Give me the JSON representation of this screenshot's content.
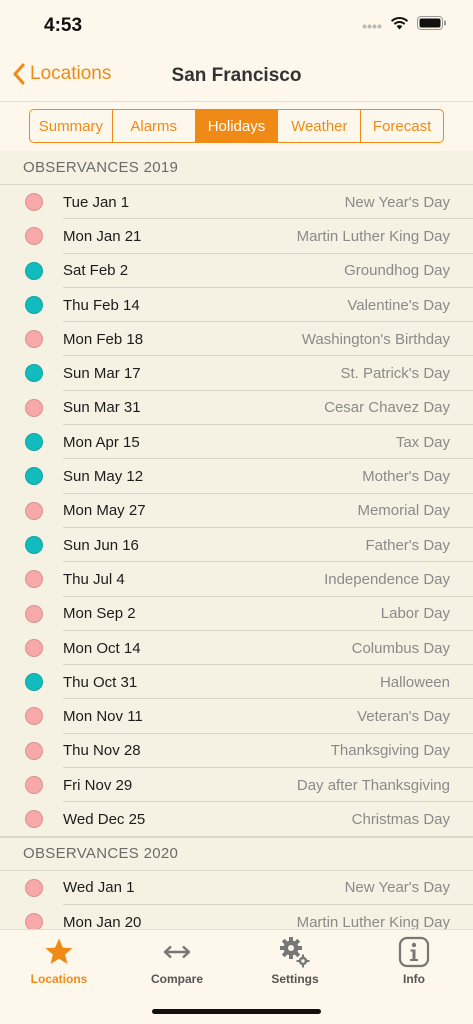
{
  "status": {
    "time": "4:53"
  },
  "nav": {
    "back_label": "Locations",
    "title": "San Francisco"
  },
  "segments": [
    {
      "label": "Summary",
      "active": false
    },
    {
      "label": "Alarms",
      "active": false
    },
    {
      "label": "Holidays",
      "active": true
    },
    {
      "label": "Weather",
      "active": false
    },
    {
      "label": "Forecast",
      "active": false
    }
  ],
  "colors": {
    "accent": "#f08a17",
    "dot_pink": "#f7a8a8",
    "dot_teal": "#12bcbc"
  },
  "sections": [
    {
      "title": "OBSERVANCES 2019",
      "items": [
        {
          "date": "Tue Jan 1",
          "name": "New Year's Day",
          "dot": "pink"
        },
        {
          "date": "Mon Jan 21",
          "name": "Martin Luther King Day",
          "dot": "pink"
        },
        {
          "date": "Sat Feb 2",
          "name": "Groundhog Day",
          "dot": "teal"
        },
        {
          "date": "Thu Feb 14",
          "name": "Valentine's Day",
          "dot": "teal"
        },
        {
          "date": "Mon Feb 18",
          "name": "Washington's Birthday",
          "dot": "pink"
        },
        {
          "date": "Sun Mar 17",
          "name": "St. Patrick's Day",
          "dot": "teal"
        },
        {
          "date": "Sun Mar 31",
          "name": "Cesar Chavez Day",
          "dot": "pink"
        },
        {
          "date": "Mon Apr 15",
          "name": "Tax Day",
          "dot": "teal"
        },
        {
          "date": "Sun May 12",
          "name": "Mother's Day",
          "dot": "teal"
        },
        {
          "date": "Mon May 27",
          "name": "Memorial Day",
          "dot": "pink"
        },
        {
          "date": "Sun Jun 16",
          "name": "Father's Day",
          "dot": "teal"
        },
        {
          "date": "Thu Jul 4",
          "name": "Independence Day",
          "dot": "pink"
        },
        {
          "date": "Mon Sep 2",
          "name": "Labor Day",
          "dot": "pink"
        },
        {
          "date": "Mon Oct 14",
          "name": "Columbus Day",
          "dot": "pink"
        },
        {
          "date": "Thu Oct 31",
          "name": "Halloween",
          "dot": "teal"
        },
        {
          "date": "Mon Nov 11",
          "name": "Veteran's Day",
          "dot": "pink"
        },
        {
          "date": "Thu Nov 28",
          "name": "Thanksgiving Day",
          "dot": "pink"
        },
        {
          "date": "Fri Nov 29",
          "name": "Day after Thanksgiving",
          "dot": "pink"
        },
        {
          "date": "Wed Dec 25",
          "name": "Christmas Day",
          "dot": "pink"
        }
      ]
    },
    {
      "title": "OBSERVANCES 2020",
      "items": [
        {
          "date": "Wed Jan 1",
          "name": "New Year's Day",
          "dot": "pink"
        },
        {
          "date": "Mon Jan 20",
          "name": "Martin Luther King Day",
          "dot": "pink"
        }
      ]
    }
  ],
  "tabs": [
    {
      "label": "Locations",
      "icon": "star-icon",
      "active": true
    },
    {
      "label": "Compare",
      "icon": "arrows-icon",
      "active": false
    },
    {
      "label": "Settings",
      "icon": "gears-icon",
      "active": false
    },
    {
      "label": "Info",
      "icon": "info-icon",
      "active": false
    }
  ]
}
